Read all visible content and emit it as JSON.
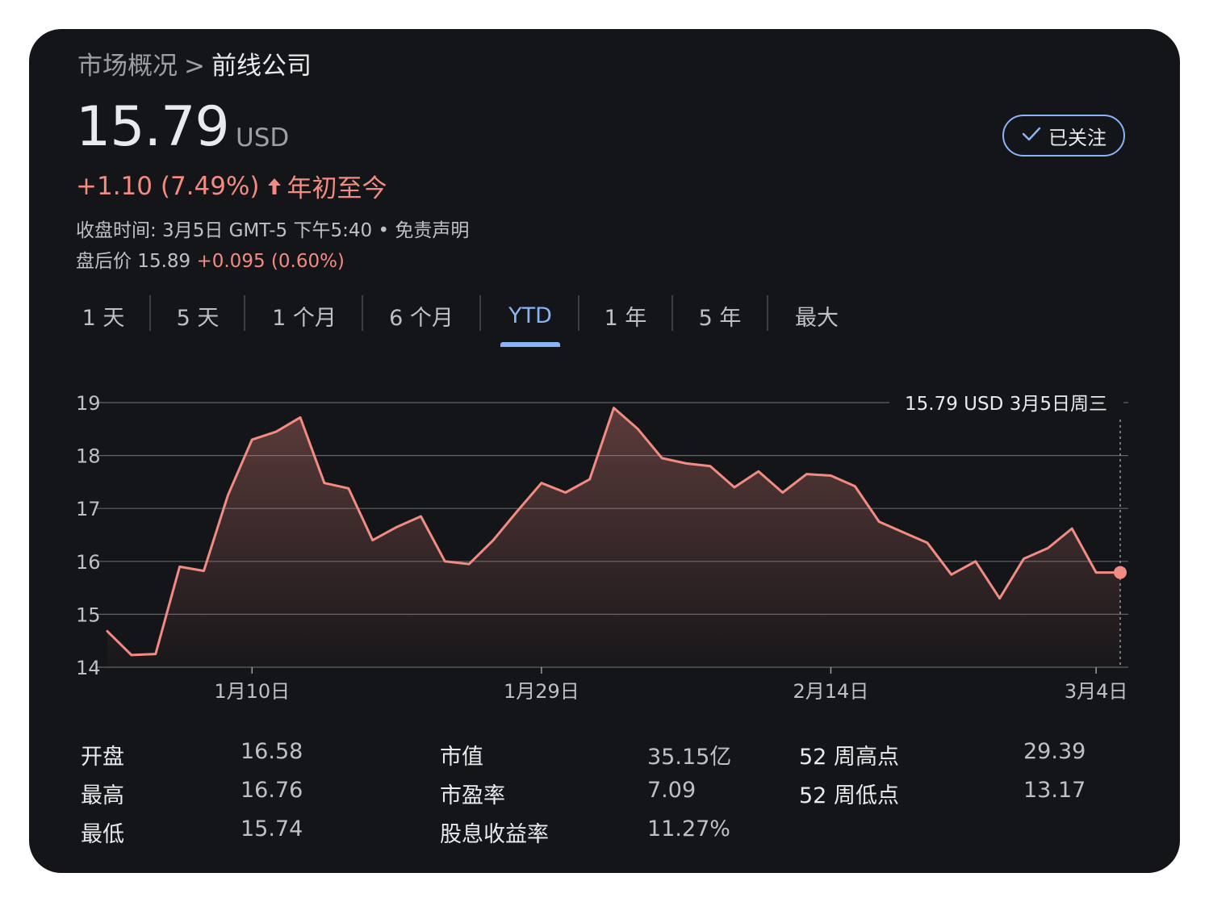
{
  "breadcrumb": {
    "parent": "市场概况",
    "separator": ">",
    "current": "前线公司"
  },
  "quote": {
    "price": "15.79",
    "currency": "USD",
    "change": "+1.10 (7.49%)",
    "period": "年初至今",
    "close_time": "收盘时间: 3月5日 GMT-5 下午5:40 • 免责声明",
    "after_hours_label": "盘后价 15.89",
    "after_hours_change": "+0.095 (0.60%)"
  },
  "follow_button": {
    "label": "已关注",
    "icon": "check-icon"
  },
  "tabs": [
    {
      "label": "1 天",
      "active": false
    },
    {
      "label": "5 天",
      "active": false
    },
    {
      "label": "1 个月",
      "active": false
    },
    {
      "label": "6 个月",
      "active": false
    },
    {
      "label": "YTD",
      "active": true
    },
    {
      "label": "1 年",
      "active": false
    },
    {
      "label": "5 年",
      "active": false
    },
    {
      "label": "最大",
      "active": false
    }
  ],
  "colors": {
    "line": "#f28b82",
    "accent": "#8ab4f8",
    "background": "#141518"
  },
  "chart_data": {
    "type": "area",
    "x_tick_labels": [
      "1月10日",
      "1月29日",
      "2月14日",
      "3月4日"
    ],
    "y_ticks": [
      14,
      15,
      16,
      17,
      18,
      19
    ],
    "ylim": [
      14,
      19
    ],
    "grid": true,
    "tooltip": {
      "price": "15.79 USD",
      "date": "3月5日周三"
    },
    "series": [
      {
        "x": [
          "12月31日",
          "1月2日",
          "1月3日",
          "1月6日",
          "1月7日",
          "1月8日",
          "1月10日",
          "1月13日",
          "1月14日",
          "1月15日",
          "1月16日",
          "1月17日",
          "1月21日",
          "1月22日",
          "1月23日",
          "1月24日",
          "1月27日",
          "1月28日",
          "1月29日",
          "1月30日",
          "1月31日",
          "2月3日",
          "2月4日",
          "2月5日",
          "2月6日",
          "2月7日",
          "2月10日",
          "2月11日",
          "2月12日",
          "2月13日",
          "2月14日",
          "2月18日",
          "2月19日",
          "2月20日",
          "2月21日",
          "2月24日",
          "2月25日",
          "2月26日",
          "2月27日",
          "2月28日",
          "3月3日",
          "3月4日",
          "3月5日"
        ],
        "y": [
          14.68,
          14.23,
          14.25,
          15.9,
          15.82,
          17.25,
          18.3,
          18.45,
          18.72,
          17.48,
          17.38,
          16.4,
          16.65,
          16.85,
          16.0,
          15.95,
          16.4,
          16.95,
          17.48,
          17.3,
          17.55,
          18.9,
          18.5,
          17.95,
          17.85,
          17.8,
          17.4,
          17.7,
          17.3,
          17.65,
          17.62,
          17.42,
          16.75,
          16.55,
          16.35,
          15.75,
          16.0,
          15.3,
          16.05,
          16.25,
          16.62,
          15.79,
          15.79
        ]
      }
    ]
  },
  "stats": [
    {
      "label": "开盘",
      "value": "16.58"
    },
    {
      "label": "最高",
      "value": "16.76"
    },
    {
      "label": "最低",
      "value": "15.74"
    },
    {
      "label": "市值",
      "value": "35.15亿"
    },
    {
      "label": "市盈率",
      "value": "7.09"
    },
    {
      "label": "股息收益率",
      "value": "11.27%"
    },
    {
      "label": "52 周高点",
      "value": "29.39"
    },
    {
      "label": "52 周低点",
      "value": "13.17"
    }
  ]
}
